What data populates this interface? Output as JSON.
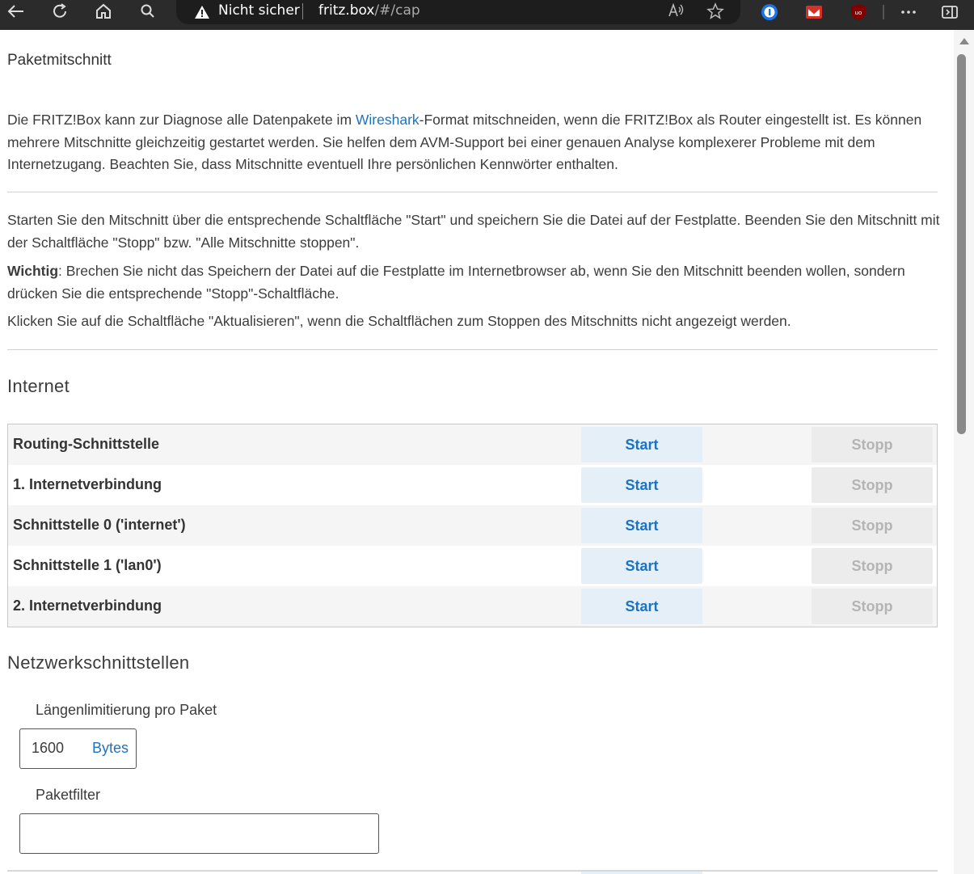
{
  "browser": {
    "security_label": "Nicht sicher",
    "url_host": "fritz.box",
    "url_path": "/#/cap"
  },
  "page": {
    "title": "Paketmitschnitt",
    "intro_prefix": "Die FRITZ!Box kann zur Diagnose alle Datenpakete im ",
    "intro_link": "Wireshark",
    "intro_suffix": "-Format mitschneiden, wenn die FRITZ!Box als Router eingestellt ist. Es können mehrere Mitschnitte gleichzeitig gestartet werden. Sie helfen dem AVM-Support bei einer genauen Analyse komplexerer Probleme mit dem Internetzugang. Beachten Sie, dass Mitschnitte eventuell Ihre persönlichen Kennwörter enthalten.",
    "instructions": "Starten Sie den Mitschnitt über die entsprechende Schaltfläche \"Start\" und speichern Sie die Datei auf der Festplatte. Beenden Sie den Mitschnitt mit der Schaltfläche \"Stopp\" bzw. \"Alle Mitschnitte stoppen\".",
    "important_label": "Wichtig",
    "important_text": ": Brechen Sie nicht das Speichern der Datei auf die Festplatte im Internetbrowser ab, wenn Sie den Mitschnitt beenden wollen, sondern drücken Sie die entsprechende \"Stopp\"-Schaltfläche.",
    "refresh_hint": "Klicken Sie auf die Schaltfläche \"Aktualisieren\", wenn die Schaltflächen zum Stoppen des Mitschnitts nicht angezeigt werden."
  },
  "internet": {
    "heading": "Internet",
    "start_label": "Start",
    "stop_label": "Stopp",
    "rows": [
      {
        "label": "Routing-Schnittstelle"
      },
      {
        "label": "1. Internetverbindung"
      },
      {
        "label": "Schnittstelle 0 ('internet')"
      },
      {
        "label": "Schnittstelle 1 ('lan0')"
      },
      {
        "label": "2. Internetverbindung"
      }
    ]
  },
  "network": {
    "heading": "Netzwerkschnittstellen",
    "length_label": "Längenlimitierung pro Paket",
    "length_value": "1600",
    "length_unit": "Bytes",
    "filter_label": "Paketfilter",
    "filter_value": ""
  }
}
